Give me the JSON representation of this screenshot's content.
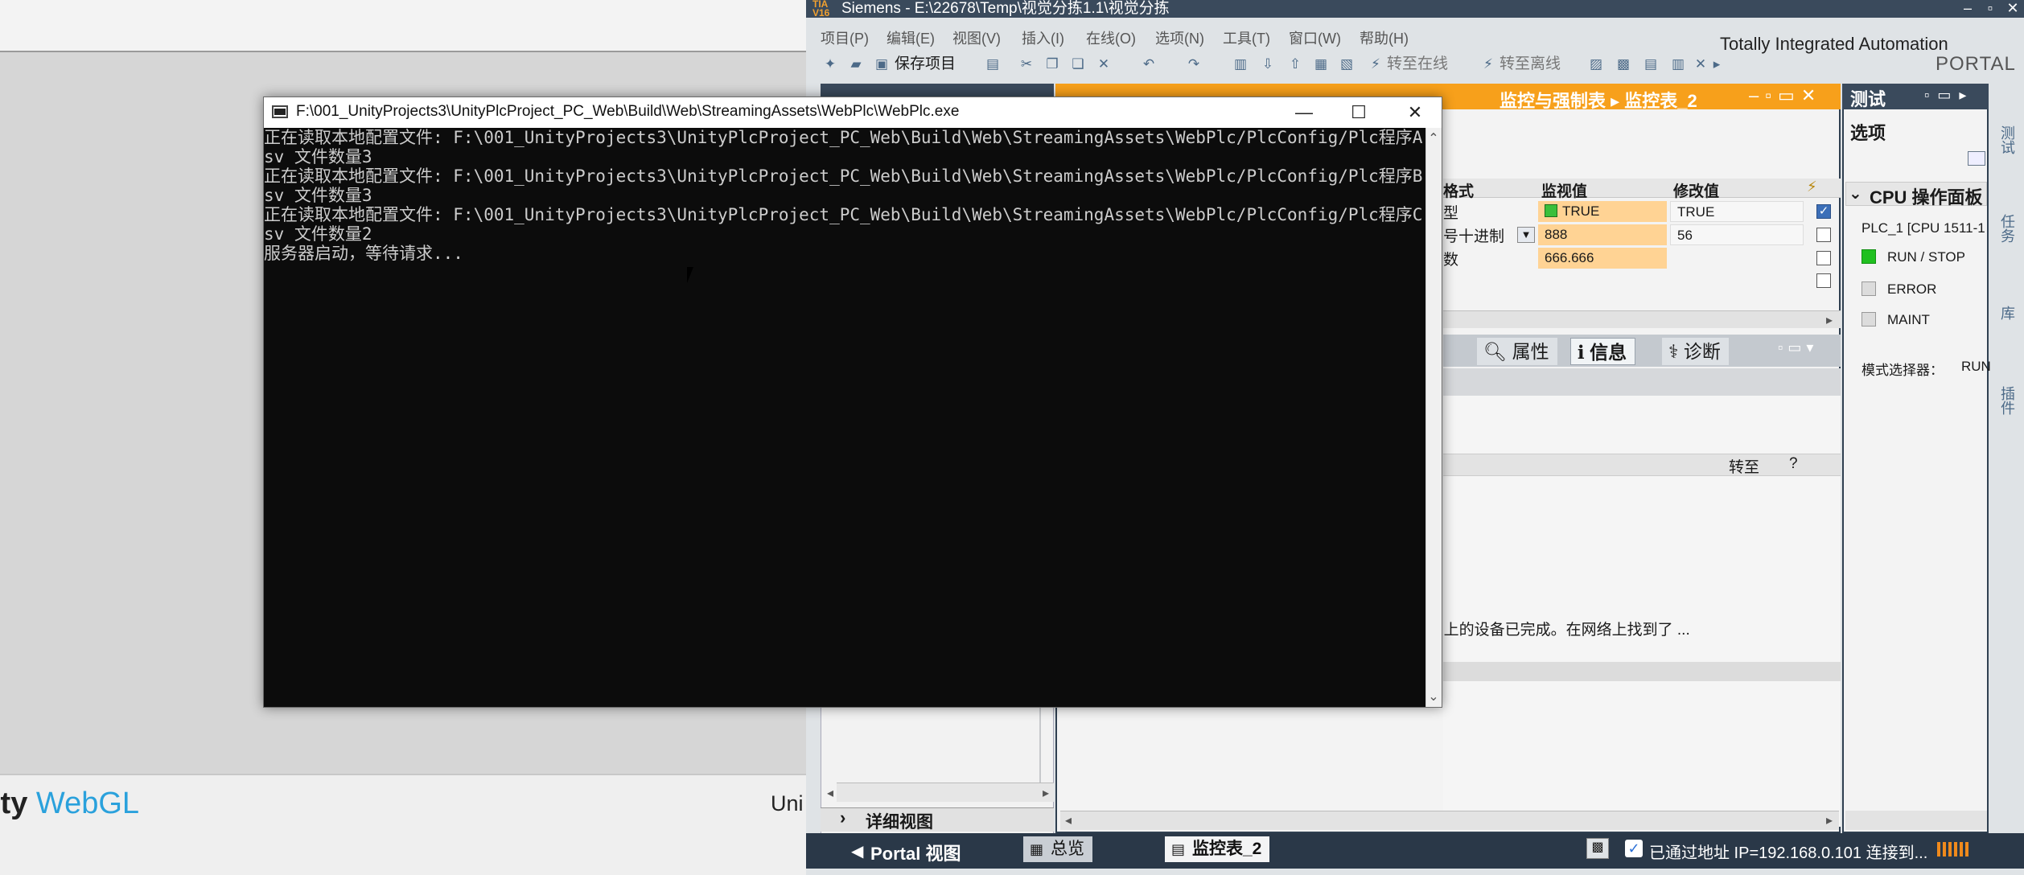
{
  "unity": {
    "logo_prefix": "ity",
    "logo_webgl": "WebGL",
    "build_text": "Uni"
  },
  "tia": {
    "title": "Siemens  -  E:\\22678\\Temp\\视觉分拣1.1\\视觉分拣",
    "logo": "TIA V16",
    "menu": [
      "项目(P)",
      "编辑(E)",
      "视图(V)",
      "插入(I)",
      "在线(O)",
      "选项(N)",
      "工具(T)",
      "窗口(W)",
      "帮助(H)"
    ],
    "brand_line1": "Totally Integrated Automation",
    "brand_line2": "PORTAL",
    "toolbar": {
      "save": "保存项目",
      "go_online": "转至在线",
      "go_offline": "转至离线"
    },
    "editor": {
      "breadcrumb": "监控与强制表  ▸  监控表_2",
      "columns": {
        "format": "格式",
        "monitor": "监视值",
        "modify": "修改值"
      },
      "rows": [
        {
          "format": "型",
          "monitor": "TRUE",
          "modify": "TRUE",
          "checked": true
        },
        {
          "format": "号十进制",
          "monitor": "888",
          "modify": "56",
          "checked": false
        },
        {
          "format": "数",
          "monitor": "666.666",
          "modify": "",
          "checked": false
        }
      ]
    },
    "inspector": {
      "tabs": {
        "properties": "属性",
        "info": "信息",
        "diagnostics": "诊断"
      },
      "goto_label": "转至",
      "help_label": "?",
      "message": "r 上的设备已完成。在网络上找到了 ..."
    },
    "task": {
      "title": "测试",
      "options": "选项",
      "panel_title": "CPU 操作面板",
      "plc": "PLC_1 [CPU 1511-1",
      "run_stop": "RUN / STOP",
      "error": "ERROR",
      "maint": "MAINT",
      "mode_selector": "模式选择器：",
      "mode_value": "RUN"
    },
    "side_tabs": [
      "测试",
      "任务",
      "库",
      "插件"
    ],
    "detail_view": "详细视图",
    "portal": {
      "view_label": "Portal 视图",
      "tab_overview": "总览",
      "tab_watch": "监控表_2",
      "status_text": "已通过地址 IP=192.168.0.101 连接到..."
    },
    "colors": {
      "accent": "#f7a01b",
      "dark": "#2a3848",
      "led_green": "#20c020"
    }
  },
  "console": {
    "title": "F:\\001_UnityProjects3\\UnityPlcProject_PC_Web\\Build\\Web\\StreamingAssets\\WebPlc\\WebPlc.exe",
    "lines": [
      "正在读取本地配置文件: F:\\001_UnityProjects3\\UnityPlcProject_PC_Web\\Build\\Web\\StreamingAssets\\WebPlc/PlcConfig/Plc程序A.c",
      "sv 文件数量3",
      "正在读取本地配置文件: F:\\001_UnityProjects3\\UnityPlcProject_PC_Web\\Build\\Web\\StreamingAssets\\WebPlc/PlcConfig/Plc程序B.c",
      "sv 文件数量3",
      "正在读取本地配置文件: F:\\001_UnityProjects3\\UnityPlcProject_PC_Web\\Build\\Web\\StreamingAssets\\WebPlc/PlcConfig/Plc程序C.c",
      "sv 文件数量2",
      "服务器启动，等待请求..."
    ]
  }
}
